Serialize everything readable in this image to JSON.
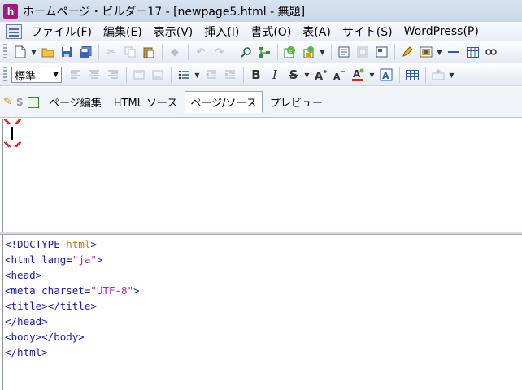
{
  "window": {
    "title": "ホームページ・ビルダー17 - [newpage5.html - 無題]",
    "app_icon_letter": "h"
  },
  "menu": {
    "items": [
      {
        "label": "ファイル(F)"
      },
      {
        "label": "編集(E)"
      },
      {
        "label": "表示(V)"
      },
      {
        "label": "挿入(I)"
      },
      {
        "label": "書式(O)"
      },
      {
        "label": "表(A)"
      },
      {
        "label": "サイト(S)"
      },
      {
        "label": "WordPress(P)"
      }
    ]
  },
  "toolbar2": {
    "paragraph_style": "標準",
    "bold_glyph": "B",
    "italic_glyph": "I",
    "strike_glyph": "S"
  },
  "view_tabs": {
    "s_label": "S",
    "tabs": [
      {
        "label": "ページ編集",
        "active": false
      },
      {
        "label": "HTML ソース",
        "active": false
      },
      {
        "label": "ページ/ソース",
        "active": true
      },
      {
        "label": "プレビュー",
        "active": false
      }
    ]
  },
  "source": {
    "lines": [
      {
        "tag": "<!DOCTYPE ",
        "kw": "html",
        "rest": ">"
      },
      {
        "tag": "<html lang=",
        "attr": "\"ja\"",
        "rest": ">"
      },
      {
        "tag": "<head>"
      },
      {
        "tag": "<meta charset=",
        "attr": "\"UTF-8\"",
        "rest": ">"
      },
      {
        "tag": "<title></title>"
      },
      {
        "tag": "</head>"
      },
      {
        "tag": "<body></body>"
      },
      {
        "tag": "</html>"
      }
    ]
  },
  "colors": {
    "tag": "#1a1aa6",
    "attribute_value": "#b020b0",
    "keyword": "#c07a00",
    "app_icon": "#a01a7a"
  }
}
